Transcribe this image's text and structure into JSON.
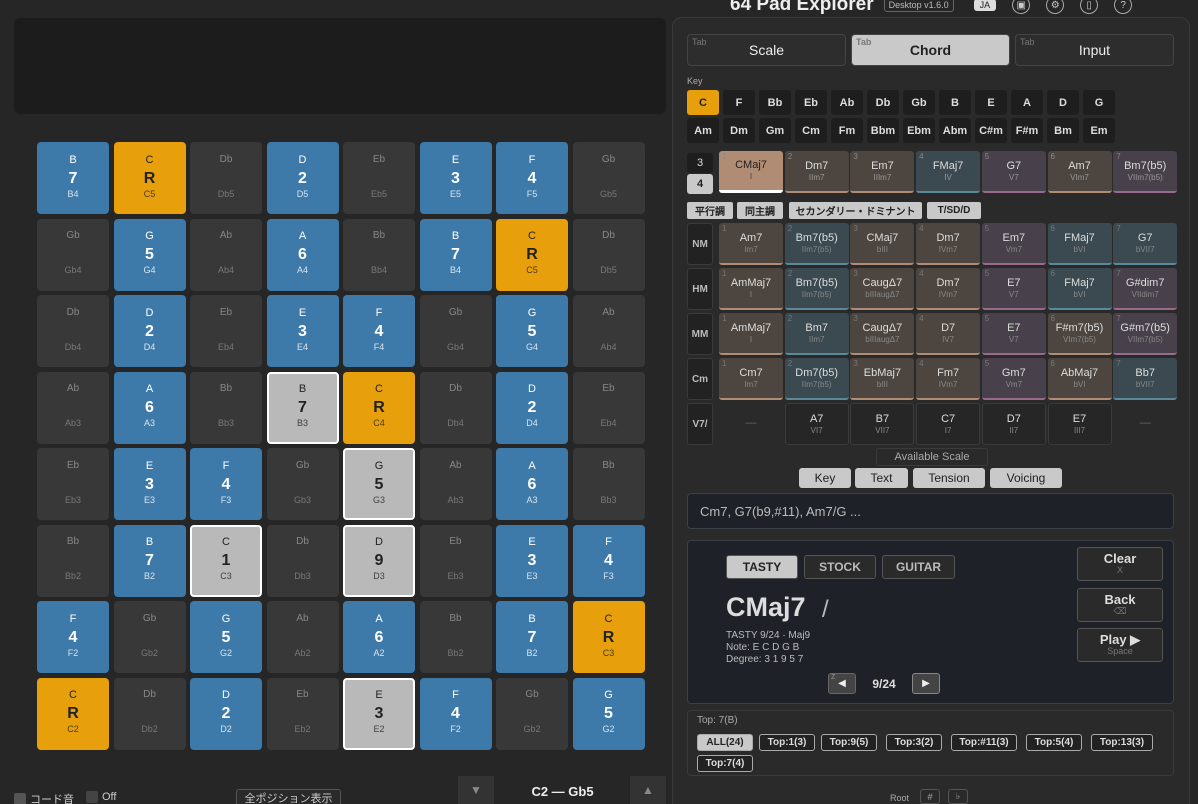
{
  "app": {
    "title": "64 Pad Explorer",
    "version": "Desktop v1.6.0",
    "lang": "JA"
  },
  "tabs": [
    {
      "hint": "Tab",
      "label": "Scale"
    },
    {
      "hint": "Tab",
      "label": "Chord"
    },
    {
      "hint": "Tab",
      "label": "Input"
    }
  ],
  "key": {
    "label": "Key",
    "major": [
      "C",
      "F",
      "Bb",
      "Eb",
      "Ab",
      "Db",
      "Gb",
      "B",
      "E",
      "A",
      "D",
      "G"
    ],
    "minor": [
      "Am",
      "Dm",
      "Gm",
      "Cm",
      "Fm",
      "Bbm",
      "Ebm",
      "Abm",
      "C#m",
      "F#m",
      "Bm",
      "Em"
    ]
  },
  "voice_count": [
    "3",
    "4"
  ],
  "diatonic": [
    {
      "n": "1",
      "name": "CMaj7",
      "roman": "I"
    },
    {
      "n": "2",
      "name": "Dm7",
      "roman": "IIm7"
    },
    {
      "n": "3",
      "name": "Em7",
      "roman": "IIIm7"
    },
    {
      "n": "4",
      "name": "FMaj7",
      "roman": "IV"
    },
    {
      "n": "5",
      "name": "G7",
      "roman": "V7"
    },
    {
      "n": "6",
      "name": "Am7",
      "roman": "VIm7"
    },
    {
      "n": "7",
      "name": "Bm7(b5)",
      "roman": "VIIm7(b5)"
    }
  ],
  "subtabs": [
    "平行調",
    "同主調",
    "セカンダリー・ドミナント",
    "T/SD/D"
  ],
  "borrow": {
    "NM": [
      [
        "1",
        "Am7",
        "Im7"
      ],
      [
        "2",
        "Bm7(b5)",
        "IIm7(b5)"
      ],
      [
        "3",
        "CMaj7",
        "bIII"
      ],
      [
        "4",
        "Dm7",
        "IVm7"
      ],
      [
        "5",
        "Em7",
        "Vm7"
      ],
      [
        "6",
        "FMaj7",
        "bVI"
      ],
      [
        "7",
        "G7",
        "bVII7"
      ]
    ],
    "HM": [
      [
        "1",
        "AmMaj7",
        "I"
      ],
      [
        "2",
        "Bm7(b5)",
        "IIm7(b5)"
      ],
      [
        "3",
        "CaugΔ7",
        "bIIIaugΔ7"
      ],
      [
        "4",
        "Dm7",
        "IVm7"
      ],
      [
        "5",
        "E7",
        "V7"
      ],
      [
        "6",
        "FMaj7",
        "bVI"
      ],
      [
        "7",
        "G#dim7",
        "VIIdim7"
      ]
    ],
    "MM": [
      [
        "1",
        "AmMaj7",
        "I"
      ],
      [
        "2",
        "Bm7",
        "IIm7"
      ],
      [
        "3",
        "CaugΔ7",
        "bIIIaugΔ7"
      ],
      [
        "4",
        "D7",
        "IV7"
      ],
      [
        "5",
        "E7",
        "V7"
      ],
      [
        "6",
        "F#m7(b5)",
        "VIm7(b5)"
      ],
      [
        "7",
        "G#m7(b5)",
        "VIIm7(b5)"
      ]
    ],
    "Cm": [
      [
        "1",
        "Cm7",
        "Im7"
      ],
      [
        "2",
        "Dm7(b5)",
        "IIm7(b5)"
      ],
      [
        "3",
        "EbMaj7",
        "bIII"
      ],
      [
        "4",
        "Fm7",
        "IVm7"
      ],
      [
        "5",
        "Gm7",
        "Vm7"
      ],
      [
        "6",
        "AbMaj7",
        "bVI"
      ],
      [
        "7",
        "Bb7",
        "bVII7"
      ]
    ],
    "V7/": [
      [
        "",
        "—",
        ""
      ],
      [
        "",
        "A7",
        "VI7"
      ],
      [
        "",
        "B7",
        "VII7"
      ],
      [
        "",
        "C7",
        "I7"
      ],
      [
        "",
        "D7",
        "II7"
      ],
      [
        "",
        "E7",
        "III7"
      ],
      [
        "",
        "—",
        ""
      ]
    ]
  },
  "available_scale": "Available Scale",
  "input_tabs": [
    "Key",
    "Text",
    "Tension",
    "Voicing"
  ],
  "search_placeholder": "Cm7, G7(b9,#11), Am7/G ...",
  "voicing": {
    "tabs": [
      "TASTY",
      "STOCK",
      "GUITAR"
    ],
    "chord": "CMaj7",
    "slash": "/",
    "line1": "TASTY 9/24 · Maj9",
    "line2": "Note: E C D G B",
    "line3": "Degree: 3 1 9 5 7",
    "page": "9/24",
    "prev_key": "Z",
    "prev": "◀",
    "next": "▶"
  },
  "actions": {
    "clear": "Clear",
    "clear_key": "X",
    "back": "Back",
    "back_key": "⌫",
    "play": "Play ▶",
    "play_key": "Space"
  },
  "top": {
    "label": "Top: 7(B)",
    "chips": [
      "ALL(24)",
      "Top:1(3)",
      "Top:9(5)",
      "Top:3(2)",
      "Top:#11(3)",
      "Top:5(4)",
      "Top:13(3)",
      "Top:7(4)"
    ]
  },
  "root": {
    "label": "Root",
    "sharp": "#",
    "flat": "♭"
  },
  "bottom": {
    "chord_tone": "コード音",
    "off": "Off",
    "all_positions": "全ポジション表示",
    "range": "C2 — Gb5",
    "down": "▼",
    "up": "▲"
  },
  "colors": {
    "scale": "#3d7aaa",
    "root": "#e89f0c",
    "out": "#383838",
    "selected": "#b9b9b9"
  },
  "pads": [
    [
      [
        "B",
        "7",
        "B4",
        "blue"
      ],
      [
        "C",
        "R",
        "C5",
        "orange"
      ],
      [
        "Db",
        "",
        "Db5",
        "gray"
      ],
      [
        "D",
        "2",
        "D5",
        "blue"
      ],
      [
        "Eb",
        "",
        "Eb5",
        "gray"
      ],
      [
        "E",
        "3",
        "E5",
        "blue"
      ],
      [
        "F",
        "4",
        "F5",
        "blue"
      ],
      [
        "Gb",
        "",
        "Gb5",
        "gray"
      ]
    ],
    [
      [
        "Gb",
        "",
        "Gb4",
        "gray"
      ],
      [
        "G",
        "5",
        "G4",
        "blue"
      ],
      [
        "Ab",
        "",
        "Ab4",
        "gray"
      ],
      [
        "A",
        "6",
        "A4",
        "blue"
      ],
      [
        "Bb",
        "",
        "Bb4",
        "gray"
      ],
      [
        "B",
        "7",
        "B4",
        "blue"
      ],
      [
        "C",
        "R",
        "C5",
        "orange"
      ],
      [
        "Db",
        "",
        "Db5",
        "gray"
      ]
    ],
    [
      [
        "Db",
        "",
        "Db4",
        "gray"
      ],
      [
        "D",
        "2",
        "D4",
        "blue"
      ],
      [
        "Eb",
        "",
        "Eb4",
        "gray"
      ],
      [
        "E",
        "3",
        "E4",
        "blue"
      ],
      [
        "F",
        "4",
        "F4",
        "blue"
      ],
      [
        "Gb",
        "",
        "Gb4",
        "gray"
      ],
      [
        "G",
        "5",
        "G4",
        "blue"
      ],
      [
        "Ab",
        "",
        "Ab4",
        "gray"
      ]
    ],
    [
      [
        "Ab",
        "",
        "Ab3",
        "gray"
      ],
      [
        "A",
        "6",
        "A3",
        "blue"
      ],
      [
        "Bb",
        "",
        "Bb3",
        "gray"
      ],
      [
        "B",
        "7",
        "B3",
        "sel"
      ],
      [
        "C",
        "R",
        "C4",
        "orange"
      ],
      [
        "Db",
        "",
        "Db4",
        "gray"
      ],
      [
        "D",
        "2",
        "D4",
        "blue"
      ],
      [
        "Eb",
        "",
        "Eb4",
        "gray"
      ]
    ],
    [
      [
        "Eb",
        "",
        "Eb3",
        "gray"
      ],
      [
        "E",
        "3",
        "E3",
        "blue"
      ],
      [
        "F",
        "4",
        "F3",
        "blue"
      ],
      [
        "Gb",
        "",
        "Gb3",
        "gray"
      ],
      [
        "G",
        "5",
        "G3",
        "sel"
      ],
      [
        "Ab",
        "",
        "Ab3",
        "gray"
      ],
      [
        "A",
        "6",
        "A3",
        "blue"
      ],
      [
        "Bb",
        "",
        "Bb3",
        "gray"
      ]
    ],
    [
      [
        "Bb",
        "",
        "Bb2",
        "gray"
      ],
      [
        "B",
        "7",
        "B2",
        "blue"
      ],
      [
        "C",
        "1",
        "C3",
        "sel"
      ],
      [
        "Db",
        "",
        "Db3",
        "gray"
      ],
      [
        "D",
        "9",
        "D3",
        "sel"
      ],
      [
        "Eb",
        "",
        "Eb3",
        "gray"
      ],
      [
        "E",
        "3",
        "E3",
        "blue"
      ],
      [
        "F",
        "4",
        "F3",
        "blue"
      ]
    ],
    [
      [
        "F",
        "4",
        "F2",
        "blue"
      ],
      [
        "Gb",
        "",
        "Gb2",
        "gray"
      ],
      [
        "G",
        "5",
        "G2",
        "blue"
      ],
      [
        "Ab",
        "",
        "Ab2",
        "gray"
      ],
      [
        "A",
        "6",
        "A2",
        "blue"
      ],
      [
        "Bb",
        "",
        "Bb2",
        "gray"
      ],
      [
        "B",
        "7",
        "B2",
        "blue"
      ],
      [
        "C",
        "R",
        "C3",
        "orange"
      ]
    ],
    [
      [
        "C",
        "R",
        "C2",
        "orange"
      ],
      [
        "Db",
        "",
        "Db2",
        "gray"
      ],
      [
        "D",
        "2",
        "D2",
        "blue"
      ],
      [
        "Eb",
        "",
        "Eb2",
        "gray"
      ],
      [
        "E",
        "3",
        "E2",
        "sel"
      ],
      [
        "F",
        "4",
        "F2",
        "blue"
      ],
      [
        "Gb",
        "",
        "Gb2",
        "gray"
      ],
      [
        "G",
        "5",
        "G2",
        "blue"
      ]
    ]
  ]
}
